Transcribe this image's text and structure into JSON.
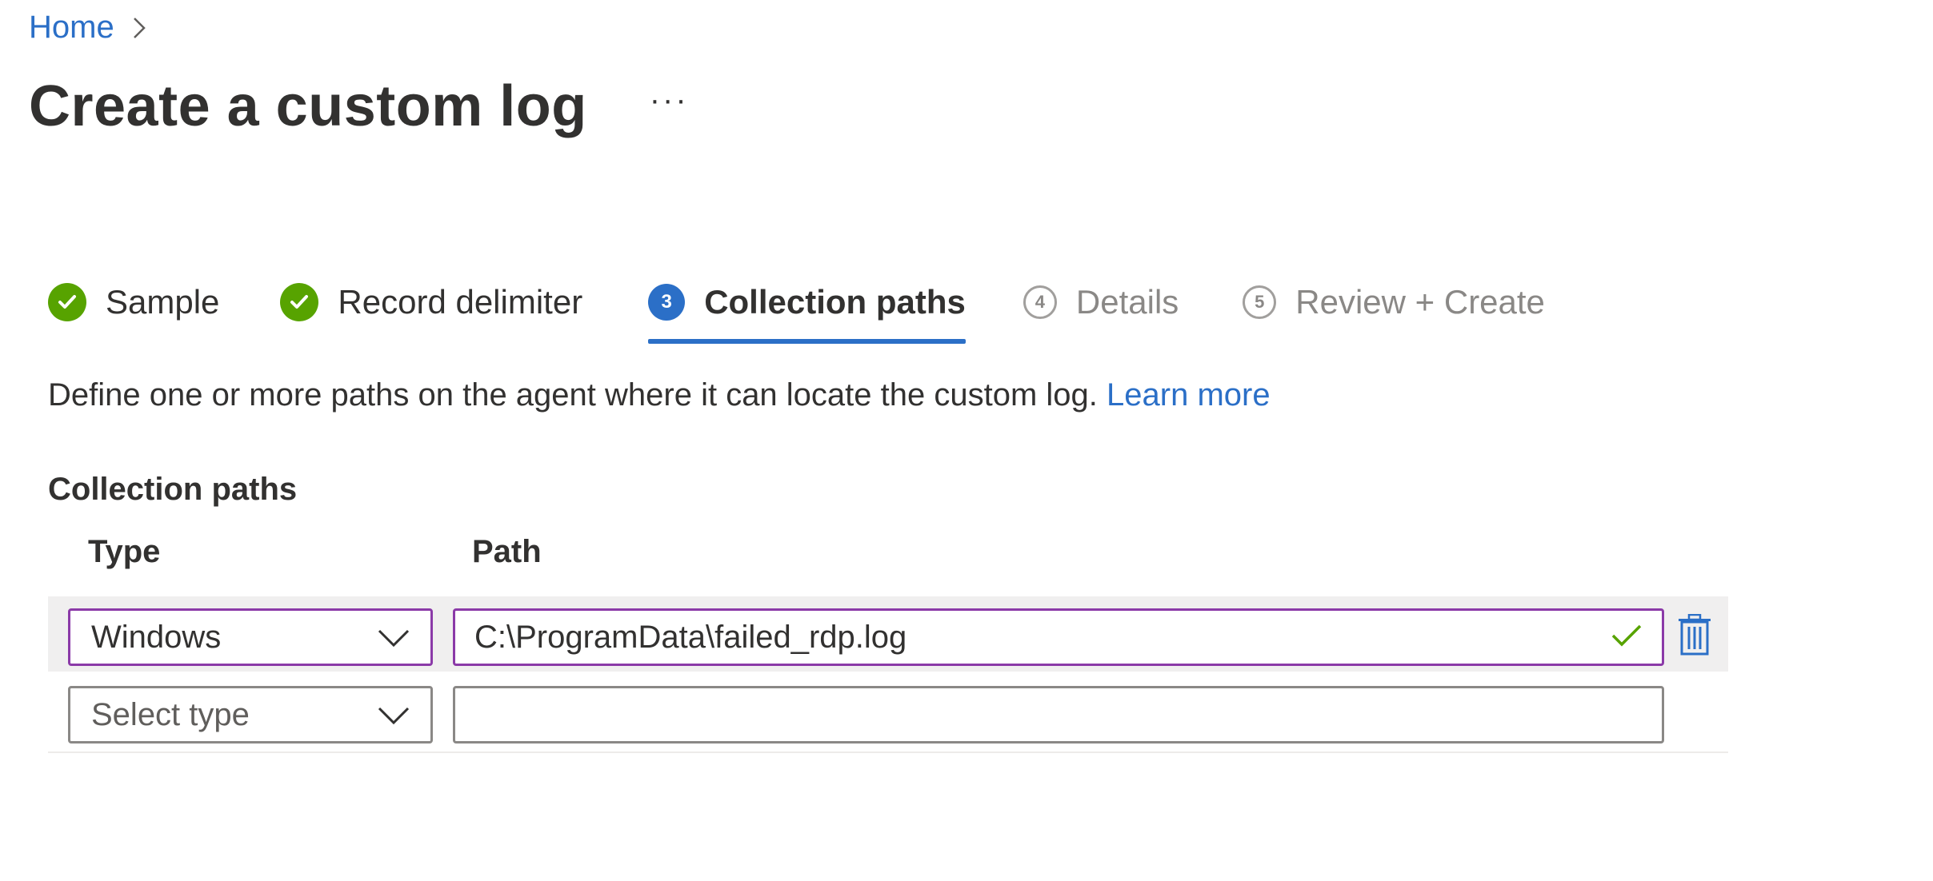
{
  "breadcrumb": {
    "home": "Home"
  },
  "title": "Create a custom log",
  "more_label": "···",
  "steps": [
    {
      "label": "Sample",
      "state": "done"
    },
    {
      "label": "Record delimiter",
      "state": "done"
    },
    {
      "number": "3",
      "label": "Collection paths",
      "state": "active"
    },
    {
      "number": "4",
      "label": "Details",
      "state": "todo"
    },
    {
      "number": "5",
      "label": "Review + Create",
      "state": "todo"
    }
  ],
  "description": {
    "text": "Define one or more paths on the agent where it can locate the custom log.",
    "link": "Learn more"
  },
  "section_title": "Collection paths",
  "columns": {
    "type": "Type",
    "path": "Path"
  },
  "rows": [
    {
      "type": "Windows",
      "path": "C:\\ProgramData\\failed_rdp.log"
    },
    {
      "type_placeholder": "Select type",
      "path": ""
    }
  ],
  "colors": {
    "accent": "#2b6fc7",
    "success": "#57a300",
    "focus_border": "#8b3aa8"
  },
  "icons": {
    "breadcrumb_separator": "chevron-right-icon",
    "step_done": "checkmark-icon",
    "dropdown": "chevron-down-icon",
    "valid": "checkmark-icon",
    "delete": "trash-icon"
  }
}
